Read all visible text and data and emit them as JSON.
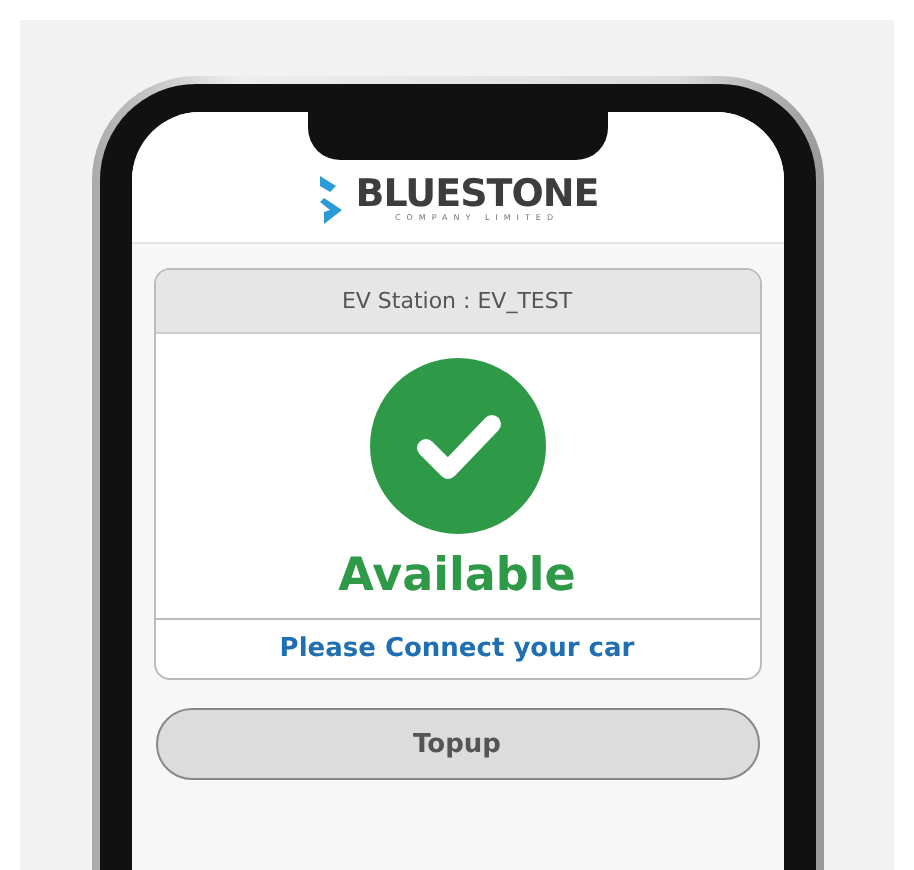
{
  "logo": {
    "name": "BLUESTONE",
    "subtitle": "COMPANY LIMITED"
  },
  "station": {
    "title": "EV Station : EV_TEST",
    "status": "Available",
    "message": "Please Connect your car"
  },
  "buttons": [
    {
      "label": "Topup"
    }
  ]
}
